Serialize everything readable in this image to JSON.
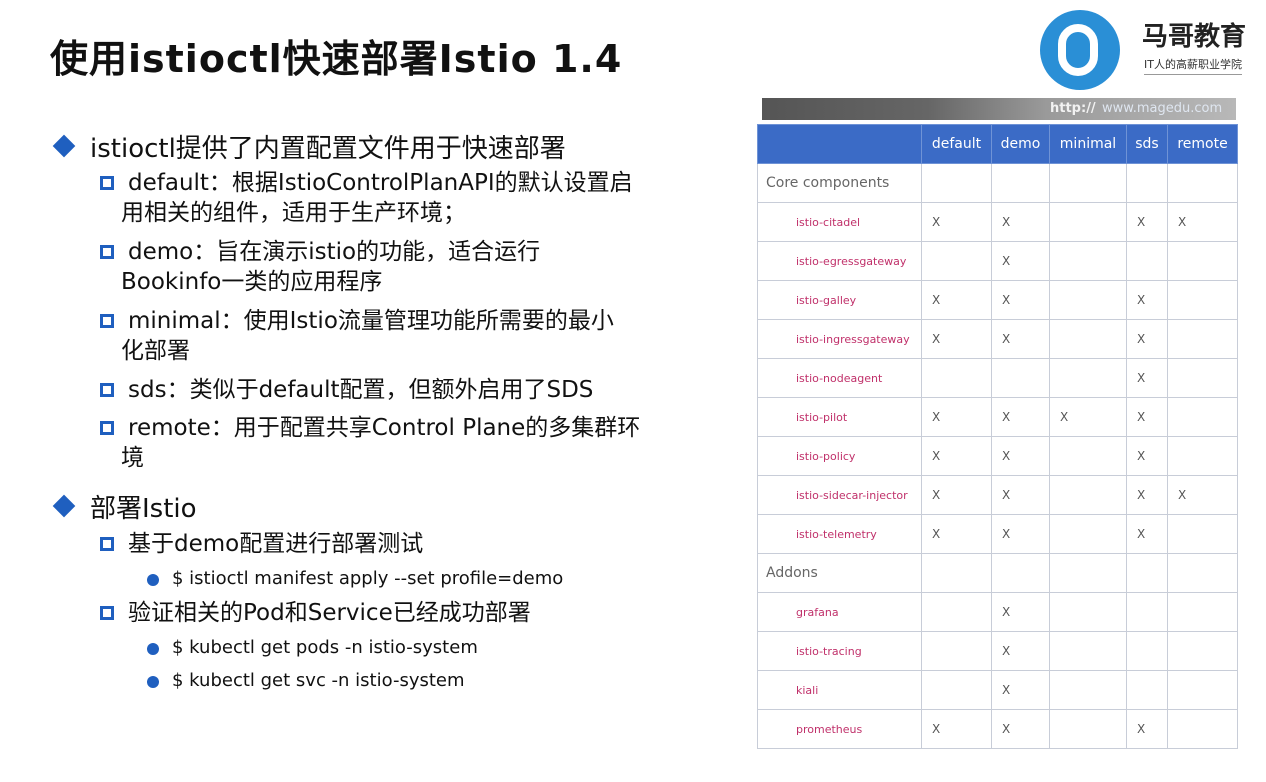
{
  "title": "使用istioctl快速部署Istio 1.4",
  "logo": {
    "name": "马哥教育",
    "subtitle": "IT人的高薪职业学院"
  },
  "url_bar": {
    "prefix": "http://",
    "host": "www.magedu.com"
  },
  "section1": {
    "heading": "istioctl提供了内置配置文件用于快速部署",
    "items": [
      {
        "line1": "default：根据IstioControlPlanAPI的默认设置启",
        "line2": "用相关的组件，适用于生产环境；"
      },
      {
        "line1": "demo：旨在演示istio的功能，适合运行",
        "line2": "Bookinfo一类的应用程序"
      },
      {
        "line1": "minimal：使用Istio流量管理功能所需要的最小",
        "line2": "化部署"
      },
      {
        "line1": "sds：类似于default配置，但额外启用了SDS",
        "line2": ""
      },
      {
        "line1": "remote：用于配置共享Control Plane的多集群环",
        "line2": "境"
      }
    ]
  },
  "section2": {
    "heading": "部署Istio",
    "sub1": {
      "label": "基于demo配置进行部署测试",
      "commands": [
        "$ istioctl manifest apply --set profile=demo"
      ]
    },
    "sub2": {
      "label": "验证相关的Pod和Service已经成功部署",
      "commands": [
        "$ kubectl get pods -n istio-system",
        "$ kubectl get svc -n istio-system"
      ]
    }
  },
  "table": {
    "headers": [
      "",
      "default",
      "demo",
      "minimal",
      "sds",
      "remote"
    ],
    "rows": [
      {
        "section": "Core components"
      },
      {
        "name": "istio-citadel",
        "marks": [
          "X",
          "X",
          "",
          "X",
          "X"
        ]
      },
      {
        "name": "istio-egressgateway",
        "marks": [
          "",
          "X",
          "",
          "",
          ""
        ]
      },
      {
        "name": "istio-galley",
        "marks": [
          "X",
          "X",
          "",
          "X",
          ""
        ]
      },
      {
        "name": "istio-ingressgateway",
        "marks": [
          "X",
          "X",
          "",
          "X",
          ""
        ]
      },
      {
        "name": "istio-nodeagent",
        "marks": [
          "",
          "",
          "",
          "X",
          ""
        ]
      },
      {
        "name": "istio-pilot",
        "marks": [
          "X",
          "X",
          "X",
          "X",
          ""
        ]
      },
      {
        "name": "istio-policy",
        "marks": [
          "X",
          "X",
          "",
          "X",
          ""
        ]
      },
      {
        "name": "istio-sidecar-injector",
        "marks": [
          "X",
          "X",
          "",
          "X",
          "X"
        ]
      },
      {
        "name": "istio-telemetry",
        "marks": [
          "X",
          "X",
          "",
          "X",
          ""
        ]
      },
      {
        "section": "Addons"
      },
      {
        "name": "grafana",
        "marks": [
          "",
          "X",
          "",
          "",
          ""
        ]
      },
      {
        "name": "istio-tracing",
        "marks": [
          "",
          "X",
          "",
          "",
          ""
        ]
      },
      {
        "name": "kiali",
        "marks": [
          "",
          "X",
          "",
          "",
          ""
        ]
      },
      {
        "name": "prometheus",
        "marks": [
          "X",
          "X",
          "",
          "X",
          ""
        ]
      }
    ]
  },
  "colors": {
    "accent": "#1f5fbf",
    "table_header": "#3b6bc6",
    "component_text": "#c0306a"
  }
}
